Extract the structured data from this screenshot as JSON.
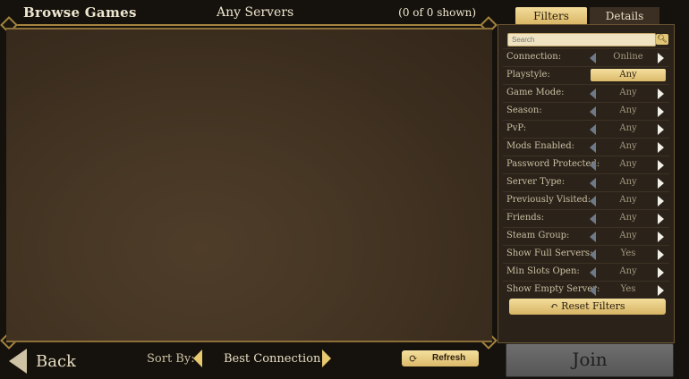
{
  "header": {
    "title": "Browse Games",
    "server_filter": "Any Servers",
    "shown_count": "(0 of 0 shown)"
  },
  "tabs": {
    "filters": "Filters",
    "details": "Details"
  },
  "search": {
    "placeholder": "Search"
  },
  "filters": [
    {
      "label": "Connection:",
      "value": "Online"
    },
    {
      "label": "Playstyle:",
      "value": "Any"
    },
    {
      "label": "Game Mode:",
      "value": "Any"
    },
    {
      "label": "Season:",
      "value": "Any"
    },
    {
      "label": "PvP:",
      "value": "Any"
    },
    {
      "label": "Mods Enabled:",
      "value": "Any"
    },
    {
      "label": "Password Protected:",
      "value": "Any"
    },
    {
      "label": "Server Type:",
      "value": "Any"
    },
    {
      "label": "Previously Visited:",
      "value": "Any"
    },
    {
      "label": "Friends:",
      "value": "Any"
    },
    {
      "label": "Steam Group:",
      "value": "Any"
    },
    {
      "label": "Show Full Servers:",
      "value": "Yes"
    },
    {
      "label": "Min Slots Open:",
      "value": "Any"
    },
    {
      "label": "Show Empty Server:",
      "value": "Yes"
    }
  ],
  "reset_label": "Reset Filters",
  "footer": {
    "back_label": "Back",
    "sort_label": "Sort By:",
    "sort_value": "Best Connection",
    "refresh_label": "Refresh",
    "join_label": "Join"
  },
  "colors": {
    "accent_gold": "#e3c777",
    "panel_brown": "#463624",
    "join_disabled": "#626262"
  }
}
